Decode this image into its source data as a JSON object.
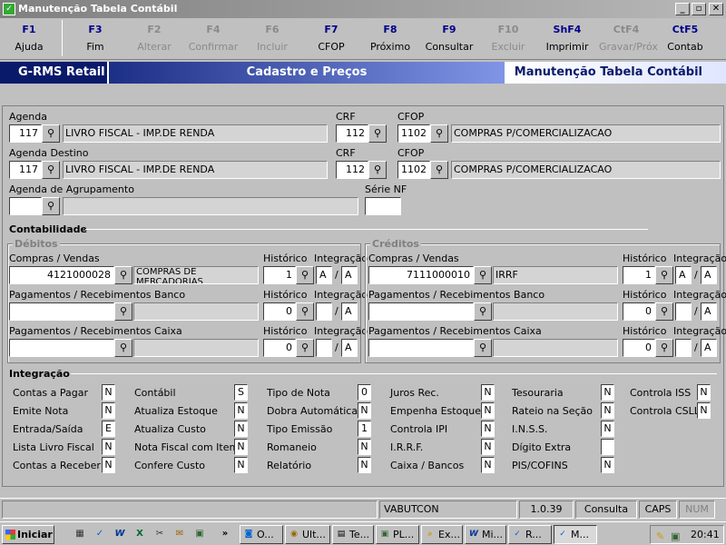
{
  "window": {
    "title": "Manutenção Tabela Contábil",
    "min": "_",
    "max": "▫",
    "close": "✕"
  },
  "fkeys": [
    {
      "key": "F1",
      "label": "Ajuda",
      "enabled": true
    },
    {
      "key": "F3",
      "label": "Fim",
      "enabled": true
    },
    {
      "key": "F2",
      "label": "Alterar",
      "enabled": false
    },
    {
      "key": "F4",
      "label": "Confirmar",
      "enabled": false
    },
    {
      "key": "F6",
      "label": "Incluir",
      "enabled": false
    },
    {
      "key": "F7",
      "label": "CFOP",
      "enabled": true
    },
    {
      "key": "F8",
      "label": "Próximo",
      "enabled": true
    },
    {
      "key": "F9",
      "label": "Consultar",
      "enabled": true
    },
    {
      "key": "F10",
      "label": "Excluir",
      "enabled": false
    },
    {
      "key": "ShF4",
      "label": "Imprimir",
      "enabled": true
    },
    {
      "key": "CtF4",
      "label": "Gravar/Próx",
      "enabled": false
    },
    {
      "key": "CtF5",
      "label": "Contab",
      "enabled": true
    }
  ],
  "header": {
    "app": "G-RMS Retail",
    "module": "Cadastro e Preços",
    "screen": "Manutenção Tabela Contábil"
  },
  "form": {
    "agenda_label": "Agenda",
    "agenda_code": "117",
    "agenda_desc": "LIVRO FISCAL - IMP.DE RENDA",
    "crf_label": "CRF",
    "crf1": "112",
    "cfop_label": "CFOP",
    "cfop1": "1102",
    "cfop1_desc": "COMPRAS P/COMERCIALIZACAO",
    "agenda_dest_label": "Agenda Destino",
    "agenda_dest_code": "117",
    "agenda_dest_desc": "LIVRO FISCAL - IMP.DE RENDA",
    "crf2": "112",
    "cfop2": "1102",
    "cfop2_desc": "COMPRAS P/COMERCIALIZACAO",
    "agrup_label": "Agenda de Agrupamento",
    "agrup_code": "",
    "agrup_desc": "",
    "serie_label": "Série NF",
    "serie": ""
  },
  "contab": {
    "title": "Contabilidade",
    "debitos": {
      "title": "Débitos",
      "rows": [
        {
          "label": "Compras / Vendas",
          "conta": "4121000028",
          "desc": "COMPRAS DE MERCADORIAS",
          "hist": "1",
          "int1": "A",
          "int2": "A"
        },
        {
          "label": "Pagamentos / Recebimentos Banco",
          "conta": "",
          "desc": "",
          "hist": "0",
          "int1": "",
          "int2": "A"
        },
        {
          "label": "Pagamentos / Recebimentos Caixa",
          "conta": "",
          "desc": "",
          "hist": "0",
          "int1": "",
          "int2": "A"
        }
      ]
    },
    "creditos": {
      "title": "Créditos",
      "rows": [
        {
          "label": "Compras / Vendas",
          "conta": "7111000010",
          "desc": "IRRF",
          "hist": "1",
          "int1": "A",
          "int2": "A"
        },
        {
          "label": "Pagamentos / Recebimentos Banco",
          "conta": "",
          "desc": "",
          "hist": "0",
          "int1": "",
          "int2": "A"
        },
        {
          "label": "Pagamentos / Recebimentos Caixa",
          "conta": "",
          "desc": "",
          "hist": "0",
          "int1": "",
          "int2": "A"
        }
      ]
    },
    "hist_label": "Histórico",
    "int_label": "Integração",
    "slash": "/"
  },
  "integracao": {
    "title": "Integração",
    "cols": [
      [
        {
          "label": "Contas a Pagar",
          "v": "N"
        },
        {
          "label": "Emite Nota",
          "v": "N"
        },
        {
          "label": "Entrada/Saída",
          "v": "E"
        },
        {
          "label": "Lista Livro Fiscal",
          "v": "N"
        },
        {
          "label": "Contas a Receber",
          "v": "N"
        }
      ],
      [
        {
          "label": "Contábil",
          "v": "S"
        },
        {
          "label": "Atualiza Estoque",
          "v": "N"
        },
        {
          "label": "Atualiza Custo",
          "v": "N"
        },
        {
          "label": "Nota Fiscal com Item",
          "v": "N"
        },
        {
          "label": "Confere Custo",
          "v": "N"
        }
      ],
      [
        {
          "label": "Tipo de Nota",
          "v": "0"
        },
        {
          "label": "Dobra Automática",
          "v": "N"
        },
        {
          "label": "Tipo Emissão",
          "v": "1"
        },
        {
          "label": "Romaneio",
          "v": "N"
        },
        {
          "label": "Relatório",
          "v": "N"
        }
      ],
      [
        {
          "label": "Juros Rec.",
          "v": "N"
        },
        {
          "label": "Empenha Estoque",
          "v": "N"
        },
        {
          "label": "Controla IPI",
          "v": "N"
        },
        {
          "label": "I.R.R.F.",
          "v": "N"
        },
        {
          "label": "Caixa / Bancos",
          "v": "N"
        }
      ],
      [
        {
          "label": "Tesouraria",
          "v": "N"
        },
        {
          "label": "Rateio na Seção",
          "v": "N"
        },
        {
          "label": "I.N.S.S.",
          "v": "N"
        },
        {
          "label": "Dígito Extra",
          "v": ""
        },
        {
          "label": "PIS/COFINS",
          "v": "N"
        }
      ],
      [
        {
          "label": "Controla ISS",
          "v": "N"
        },
        {
          "label": "Controla CSLL",
          "v": "N"
        }
      ]
    ]
  },
  "status": {
    "user": "VABUTCON",
    "version": "1.0.39",
    "mode": "Consulta",
    "caps": "CAPS",
    "num": "NUM"
  },
  "taskbar": {
    "start": "Iniciar",
    "more": "»",
    "tasks": [
      "O...",
      "Ult...",
      "Te...",
      "PL...",
      "Ex...",
      "Mi...",
      "R...",
      "M..."
    ],
    "clock": "20:41"
  }
}
